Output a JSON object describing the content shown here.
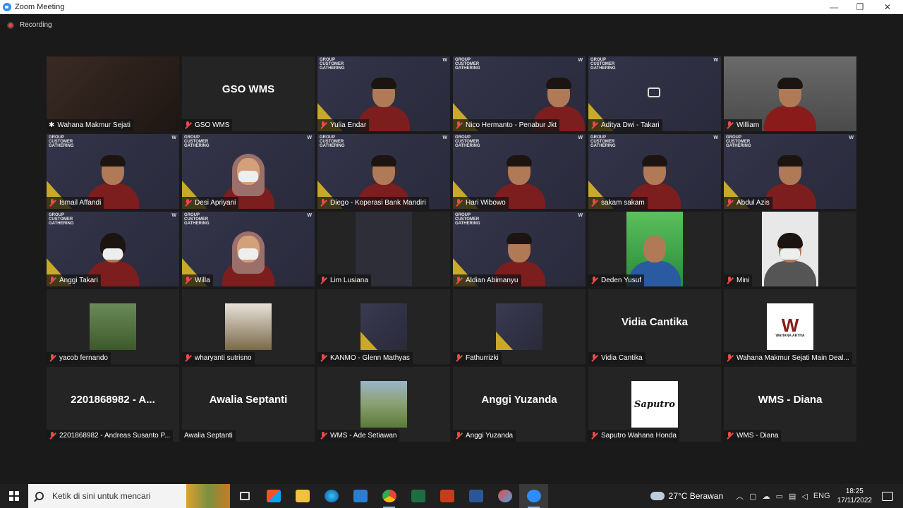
{
  "window": {
    "title": "Zoom Meeting",
    "minimize": "—",
    "restore": "❐",
    "close": "✕"
  },
  "recording": {
    "label": "Recording"
  },
  "slide": {
    "line1": "GROUP",
    "line2": "CUSTOMER",
    "line3": "GATHERING",
    "logo": "W"
  },
  "participants": [
    {
      "name": "Wahana Makmur Sejati",
      "kind": "video-dark",
      "active": true,
      "pinned": true
    },
    {
      "name": "GSO WMS",
      "kind": "name",
      "display": "GSO WMS"
    },
    {
      "name": "Yulia Endar",
      "kind": "slide-person"
    },
    {
      "name": "Nico Hermanto - Penabur Jkt",
      "kind": "slide"
    },
    {
      "name": "Aditya Dwi - Takari",
      "kind": "slide-off"
    },
    {
      "name": "William",
      "kind": "video-red"
    },
    {
      "name": "Ismail Affandi",
      "kind": "slide-person"
    },
    {
      "name": "Desi Apriyani",
      "kind": "slide-hijab"
    },
    {
      "name": "Diego - Koperasi Bank Mandiri",
      "kind": "slide-person"
    },
    {
      "name": "Hari Wibowo",
      "kind": "slide-person"
    },
    {
      "name": "sakam sakam",
      "kind": "slide-person"
    },
    {
      "name": "Abdul Azis",
      "kind": "slide-person"
    },
    {
      "name": "Anggi Takari",
      "kind": "slide-mask"
    },
    {
      "name": "Willa",
      "kind": "slide-hijab"
    },
    {
      "name": "Lim Lusiana",
      "kind": "dark-portrait"
    },
    {
      "name": "Aldian Abimanyu",
      "kind": "slide-person"
    },
    {
      "name": "Deden Yusuf",
      "kind": "green-portrait"
    },
    {
      "name": "Mini",
      "kind": "white-portrait"
    },
    {
      "name": "yacob fernando",
      "kind": "thumb-nature"
    },
    {
      "name": "wharyanti sutrisno",
      "kind": "thumb-portrait"
    },
    {
      "name": "KANMO - Glenn Mathyas",
      "kind": "thumb-slide"
    },
    {
      "name": "Fathurrizki",
      "kind": "thumb-slide"
    },
    {
      "name": "Vidia Cantika",
      "kind": "name",
      "display": "Vidia Cantika"
    },
    {
      "name": "Wahana Makmur Sejati Main Deal...",
      "kind": "thumb-wahana",
      "logo_text": "W",
      "logo_sub": "WAHANA ARTHA"
    },
    {
      "name": "2201868982 - Andreas Susanto P...",
      "kind": "name",
      "display": "2201868982  -  A..."
    },
    {
      "name": "Awalia Septanti",
      "kind": "name",
      "display": "Awalia Septanti",
      "no_mic": true
    },
    {
      "name": "WMS - Ade Setiawan",
      "kind": "thumb-mountain"
    },
    {
      "name": "Anggi Yuzanda",
      "kind": "name",
      "display": "Anggi Yuzanda"
    },
    {
      "name": "Saputro Wahana Honda",
      "kind": "thumb-saputro",
      "logo_text": "Saputro"
    },
    {
      "name": "WMS - Diana",
      "kind": "name",
      "display": "WMS - Diana"
    }
  ],
  "taskbar": {
    "search_placeholder": "Ketik di sini untuk mencari",
    "weather": "27°C  Berawan",
    "language": "ENG",
    "time": "18:25",
    "date": "17/11/2022"
  },
  "colors": {
    "active_speaker": "#c8e03a",
    "mic_muted": "#e94b4b",
    "zoom_blue": "#2d8cff"
  }
}
